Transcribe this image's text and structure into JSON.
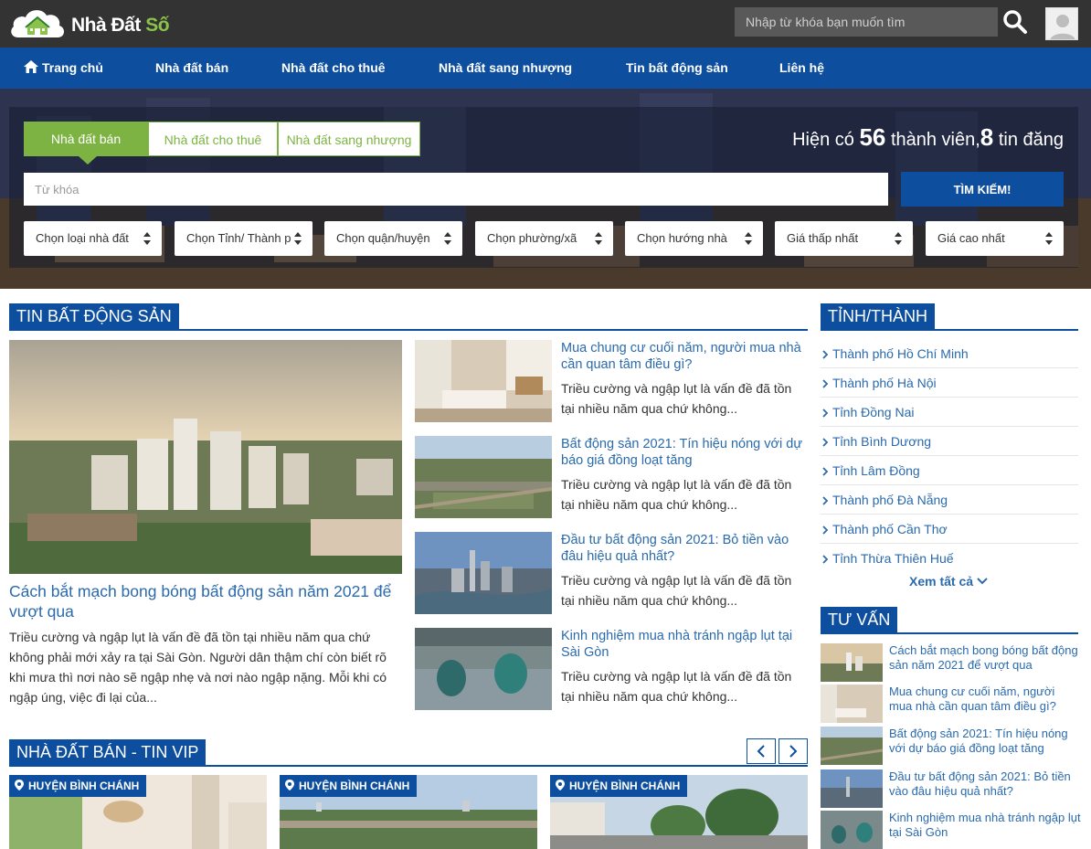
{
  "brand": {
    "name_main": "Nhà Đất",
    "name_accent": "Số"
  },
  "top_search": {
    "placeholder": "Nhập từ khóa bạn muốn tìm"
  },
  "nav": {
    "home": "Trang chủ",
    "items": [
      "Nhà đất bán",
      "Nhà đất cho thuê",
      "Nhà đất sang nhượng",
      "Tin bất động sản",
      "Liên hệ"
    ]
  },
  "search": {
    "tabs": [
      "Nhà đất bán",
      "Nhà đất cho thuê",
      "Nhà đất sang nhượng"
    ],
    "stats_prefix": "Hiện có",
    "members": "56",
    "members_label": "thành viên,",
    "posts": "8",
    "posts_label": "tin đăng",
    "keyword_placeholder": "Từ khóa",
    "button": "TÌM KIẾM!",
    "filters": [
      "Chọn loại nhà đất",
      "Chọn Tỉnh/ Thành phố",
      "Chọn quận/huyện",
      "Chọn phường/xã",
      "Chọn hướng nhà",
      "Giá thấp nhất",
      "Giá cao nhất"
    ]
  },
  "news": {
    "heading": "TIN BẤT ĐỘNG SẢN",
    "main": {
      "title": "Cách bắt mạch bong bóng bất động sản năm 2021 để vượt qua",
      "desc": "Triều cường và ngập lụt là vấn đề đã tồn tại nhiều năm qua chứ không phải mới xảy ra tại Sài Gòn. Người dân thậm chí còn biết rõ khi mưa thì nơi nào sẽ ngập nhẹ và nơi nào ngập nặng. Mỗi khi có ngập úng, việc đi lại của..."
    },
    "items": [
      {
        "title": "Mua chung cư cuối năm, người mua nhà cần quan tâm điều gì?",
        "desc": "Triều cường và ngập lụt là vấn đề đã tồn tại nhiều năm qua chứ không..."
      },
      {
        "title": "Bất động sản 2021: Tín hiệu nóng với dự báo giá đồng loạt tăng",
        "desc": "Triều cường và ngập lụt là vấn đề đã tồn tại nhiều năm qua chứ không..."
      },
      {
        "title": "Đầu tư bất động sản 2021: Bỏ tiền vào đâu hiệu quả nhất?",
        "desc": "Triều cường và ngập lụt là vấn đề đã tồn tại nhiều năm qua chứ không..."
      },
      {
        "title": "Kinh nghiệm mua nhà tránh ngập lụt tại Sài Gòn",
        "desc": "Triều cường và ngập lụt là vấn đề đã tồn tại nhiều năm qua chứ không..."
      }
    ]
  },
  "provinces": {
    "heading": "TỈNH/THÀNH",
    "items": [
      "Thành phố Hồ Chí Minh",
      "Thành phố Hà Nội",
      "Tỉnh Đồng Nai",
      "Tỉnh Bình Dương",
      "Tỉnh Lâm Đồng",
      "Thành phố Đà Nẵng",
      "Thành phố Cần Thơ",
      "Tỉnh Thừa Thiên Huế"
    ],
    "see_all": "Xem tất cả"
  },
  "advice": {
    "heading": "TƯ VẤN",
    "items": [
      "Cách bắt mạch bong bóng bất động sản năm 2021 để vượt qua",
      "Mua chung cư cuối năm, người mua nhà cần quan tâm điều gì?",
      "Bất động sản 2021: Tín hiệu nóng với dự báo giá đồng loạt tăng",
      "Đầu tư bất động sản 2021: Bỏ tiền vào đâu hiệu quả nhất?",
      "Kinh nghiệm mua nhà tránh ngập lụt tại Sài Gòn"
    ]
  },
  "vip": {
    "heading": "NHÀ ĐẤT BÁN - TIN VIP",
    "cards": [
      {
        "location": "HUYỆN BÌNH CHÁNH"
      },
      {
        "location": "HUYỆN BÌNH CHÁNH"
      },
      {
        "location": "HUYỆN BÌNH CHÁNH"
      }
    ]
  },
  "colors": {
    "primary": "#0d4f9e",
    "accent_green": "#7cb342",
    "topbar": "#333333",
    "link": "#2a6aad"
  }
}
